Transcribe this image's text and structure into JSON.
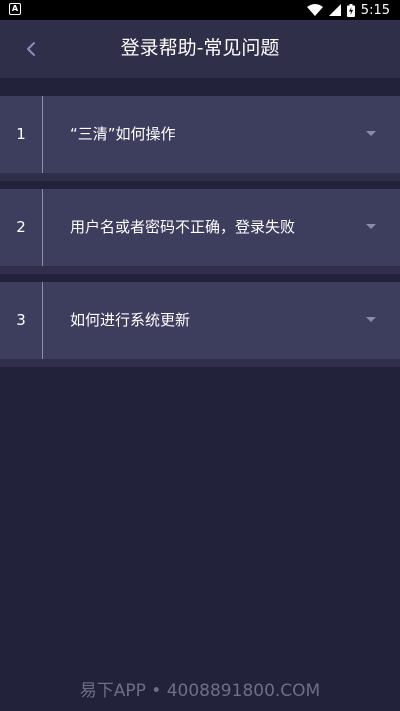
{
  "status_bar": {
    "left_icon_letter": "A",
    "time": "5:15"
  },
  "header": {
    "title": "登录帮助-常见问题",
    "back_icon": "chevron-left-icon"
  },
  "faq": {
    "items": [
      {
        "number": "1",
        "question": "“三清”如何操作"
      },
      {
        "number": "2",
        "question": "用户名或者密码不正确，登录失败"
      },
      {
        "number": "3",
        "question": "如何进行系统更新"
      }
    ],
    "expand_icon": "caret-down-icon"
  },
  "watermark": {
    "text": "易下APP • 4008891800.COM"
  },
  "colors": {
    "background": "#22223a",
    "header": "#2f2f4a",
    "item": "#3d3d5e",
    "accent_icon": "#8b8ba6"
  }
}
